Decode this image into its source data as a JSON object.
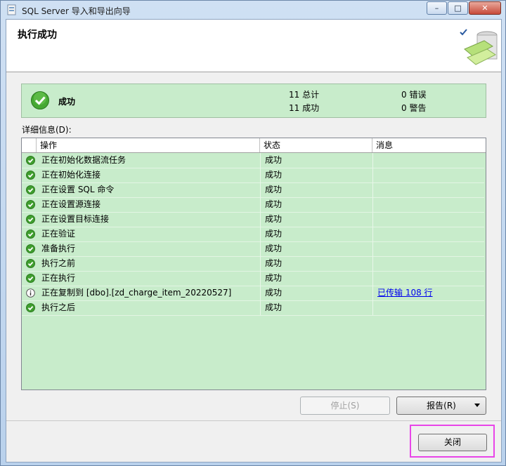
{
  "window": {
    "title": "SQL Server 导入和导出向导"
  },
  "header": {
    "title": "执行成功"
  },
  "summary": {
    "status": "成功",
    "total_label": "11 总计",
    "success_label": "11 成功",
    "error_label": "0 错误",
    "warning_label": "0 警告"
  },
  "details": {
    "label": "详细信息(D):",
    "columns": {
      "op": "操作",
      "status": "状态",
      "message": "消息"
    },
    "rows": [
      {
        "icon": "success-icon",
        "op": "正在初始化数据流任务",
        "status": "成功",
        "message": ""
      },
      {
        "icon": "success-icon",
        "op": "正在初始化连接",
        "status": "成功",
        "message": ""
      },
      {
        "icon": "success-icon",
        "op": "正在设置 SQL 命令",
        "status": "成功",
        "message": ""
      },
      {
        "icon": "success-icon",
        "op": "正在设置源连接",
        "status": "成功",
        "message": ""
      },
      {
        "icon": "success-icon",
        "op": "正在设置目标连接",
        "status": "成功",
        "message": ""
      },
      {
        "icon": "success-icon",
        "op": "正在验证",
        "status": "成功",
        "message": ""
      },
      {
        "icon": "success-icon",
        "op": "准备执行",
        "status": "成功",
        "message": ""
      },
      {
        "icon": "success-icon",
        "op": "执行之前",
        "status": "成功",
        "message": ""
      },
      {
        "icon": "success-icon",
        "op": "正在执行",
        "status": "成功",
        "message": ""
      },
      {
        "icon": "info-icon",
        "op": "正在复制到 [dbo].[zd_charge_item_20220527]",
        "status": "成功",
        "message": "已传输 108 行"
      },
      {
        "icon": "success-icon",
        "op": "执行之后",
        "status": "成功",
        "message": ""
      }
    ]
  },
  "buttons": {
    "stop": "停止(S)",
    "report": "报告(R)",
    "close": "关闭"
  },
  "colors": {
    "grid_bg": "#c8eccb",
    "success_green": "#3a9a2c",
    "highlight": "#e845e8"
  }
}
